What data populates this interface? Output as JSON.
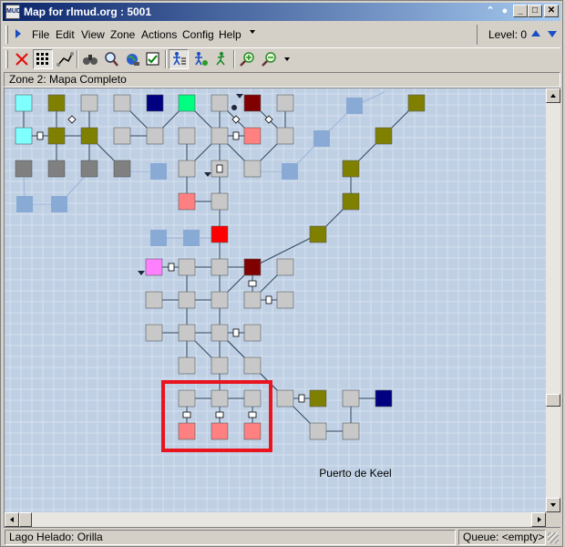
{
  "window": {
    "title": "Map for rlmud.org : 5001",
    "icon_text": "MUD",
    "controls": [
      "chevron-up-icon",
      "circle-icon",
      "minimize",
      "maximize",
      "close"
    ]
  },
  "menu": {
    "items": [
      "File",
      "Edit",
      "View",
      "Zone",
      "Actions",
      "Config",
      "Help"
    ],
    "level_label": "Level: 0"
  },
  "toolbar": {
    "buttons": [
      "delete-x-icon",
      "grid-mode-icon",
      "route-icon",
      "binoculars-icon",
      "find-icon",
      "globe-icon",
      "checkbox-icon",
      "walk-mode-icon",
      "walk-to-icon",
      "run-icon",
      "zoom-in-icon",
      "zoom-out-icon"
    ]
  },
  "zone": {
    "title": "Zone 2: Mapa Completo"
  },
  "map": {
    "label": "Puerto de Keel",
    "colors": {
      "background": "#c0d0e4",
      "grid": "#d4e0ee",
      "faded_room": "#88aad4",
      "room": "#c8c8c8",
      "olive": "#808000",
      "red": "#ff0000",
      "dark_red": "#800000",
      "navy": "#000080",
      "cyan": "#80ffff",
      "green": "#00ff80",
      "salmon": "#ff8080",
      "magenta": "#ff80ff",
      "gray": "#808080",
      "selection": "#e8141e"
    }
  },
  "status": {
    "location": "Lago Helado: Orilla",
    "queue": "Queue: <empty>"
  }
}
